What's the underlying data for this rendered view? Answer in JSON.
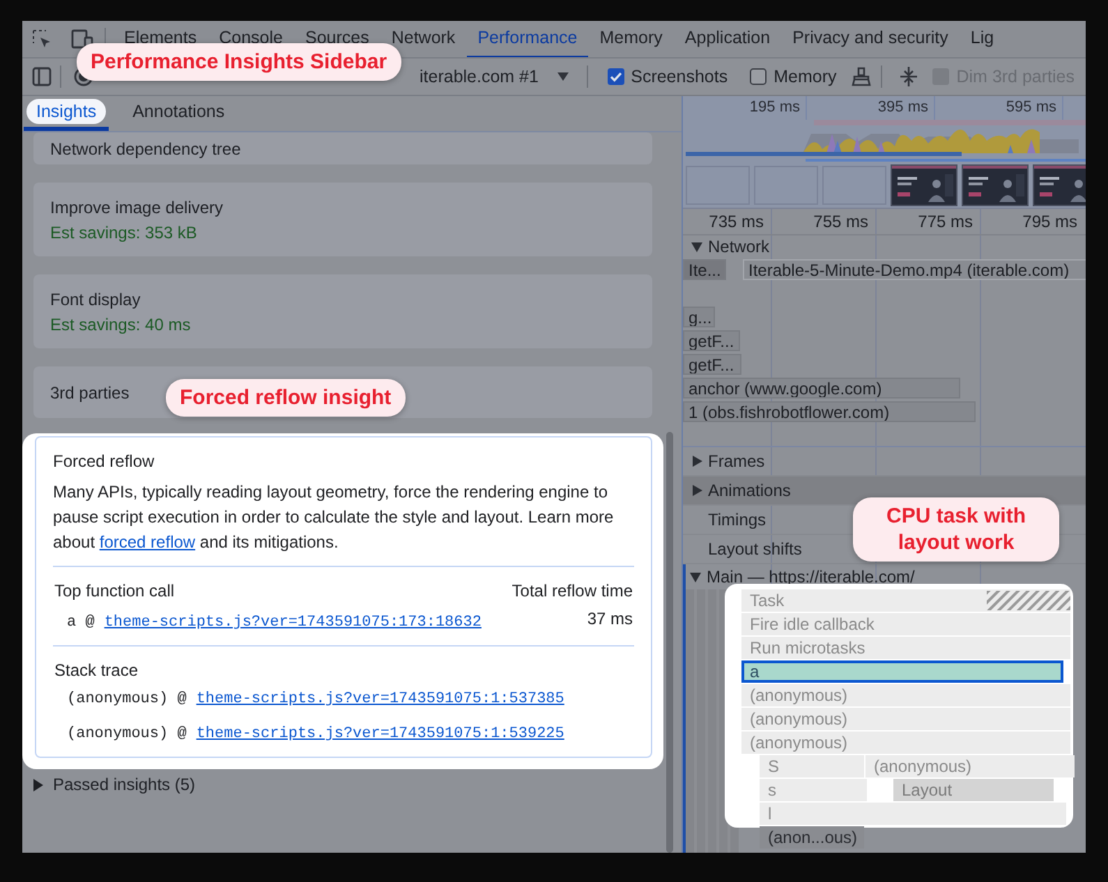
{
  "tabs": [
    {
      "label": "Elements",
      "selected": false
    },
    {
      "label": "Console",
      "selected": false
    },
    {
      "label": "Sources",
      "selected": false
    },
    {
      "label": "Network",
      "selected": false
    },
    {
      "label": "Performance",
      "selected": true
    },
    {
      "label": "Memory",
      "selected": false
    },
    {
      "label": "Application",
      "selected": false
    },
    {
      "label": "Privacy and security",
      "selected": false
    },
    {
      "label": "Lig",
      "selected": false
    }
  ],
  "toolbar": {
    "recording": "iterable.com #1",
    "checkboxes": [
      {
        "label": "Screenshots",
        "checked": true,
        "disabled": false
      },
      {
        "label": "Memory",
        "checked": false,
        "disabled": false
      },
      {
        "label": "Dim 3rd parties",
        "checked": false,
        "disabled": true
      }
    ]
  },
  "sidebar": {
    "tabs": [
      {
        "label": "Insights",
        "selected": true
      },
      {
        "label": "Annotations",
        "selected": false
      }
    ],
    "insights": [
      {
        "title": "Network dependency tree"
      },
      {
        "title": "Improve image delivery",
        "savings": "Est savings: 353 kB"
      },
      {
        "title": "Font display",
        "savings": "Est savings: 40 ms"
      },
      {
        "title": "3rd parties"
      }
    ],
    "forced_reflow": {
      "title": "Forced reflow",
      "description": "Many APIs, typically reading layout geometry, force the rendering engine to pause script execution in order to calculate the style and layout. Learn more about ",
      "link": "forced reflow",
      "description_end": " and its mitigations.",
      "function_heading": "Top function call",
      "time_heading": "Total reflow time",
      "top_function": {
        "caller": "a @",
        "source": "theme-scripts.js?ver=1743591075:173:18632",
        "time": "37 ms"
      },
      "stack_heading": "Stack trace",
      "stack": [
        {
          "caller": "(anonymous) @",
          "source": "theme-scripts.js?ver=1743591075:1:537385"
        },
        {
          "caller": "(anonymous) @",
          "source": "theme-scripts.js?ver=1743591075:1:539225"
        }
      ]
    },
    "passed": {
      "label": "Passed insights (5)",
      "expanded": false
    }
  },
  "timeline": {
    "overview_ticks": [
      "195 ms",
      "395 ms",
      "595 ms"
    ],
    "thumbnails": [
      {
        "kind": "empty"
      },
      {
        "kind": "empty"
      },
      {
        "kind": "empty"
      },
      {
        "kind": "picture"
      },
      {
        "kind": "picture"
      },
      {
        "kind": "picture"
      }
    ],
    "ruler_ticks": [
      "735 ms",
      "755 ms",
      "775 ms",
      "795 ms"
    ],
    "tracks": [
      {
        "kind": "network",
        "label": "Network",
        "expanded": true,
        "requests": [
          {
            "bars": [
              "Ite...",
              "Iterable-5-Minute-Demo.mp4 (iterable.com)"
            ]
          },
          {
            "bars": [
              "g..."
            ]
          },
          {
            "bars": [
              "getF..."
            ]
          },
          {
            "bars": [
              "getF..."
            ]
          },
          {
            "bars": [
              "anchor (www.google.com)"
            ]
          },
          {
            "bars": [
              "1 (obs.fishrobotflower.com)"
            ]
          }
        ]
      },
      {
        "kind": "group",
        "label": "Frames",
        "expanded": false
      },
      {
        "kind": "group",
        "label": "Animations",
        "expanded": false
      },
      {
        "kind": "plain",
        "label": "Timings"
      },
      {
        "kind": "plain",
        "label": "Layout shifts"
      },
      {
        "kind": "main",
        "label": "Main — https://iterable.com/",
        "expanded": true,
        "flame": [
          {
            "entries": [
              {
                "label": "Task",
                "selected": false
              }
            ]
          },
          {
            "entries": [
              {
                "label": "Fire idle callback",
                "selected": false
              }
            ]
          },
          {
            "entries": [
              {
                "label": "Run microtasks",
                "selected": false
              }
            ]
          },
          {
            "entries": [
              {
                "label": "a",
                "selected": true
              }
            ]
          },
          {
            "entries": [
              {
                "label": "(anonymous)",
                "selected": false
              }
            ]
          },
          {
            "entries": [
              {
                "label": "(anonymous)",
                "selected": false
              }
            ]
          },
          {
            "entries": [
              {
                "label": "(anonymous)",
                "selected": false
              }
            ]
          },
          {
            "entries": [
              {
                "label": "S",
                "selected": false
              },
              {
                "label": "(anonymous)",
                "selected": false
              }
            ]
          },
          {
            "entries": [
              {
                "label": "s",
                "selected": false
              },
              {
                "label": "Layout",
                "selected": false
              }
            ]
          },
          {
            "entries": [
              {
                "label": "l",
                "selected": false
              }
            ]
          },
          {
            "entries": [
              {
                "label": "(anon...ous)",
                "selected": false
              }
            ]
          }
        ]
      }
    ]
  },
  "callouts": [
    {
      "text": "Performance Insights Sidebar"
    },
    {
      "text": "Forced reflow insight"
    },
    {
      "text": "CPU task with layout work"
    }
  ]
}
